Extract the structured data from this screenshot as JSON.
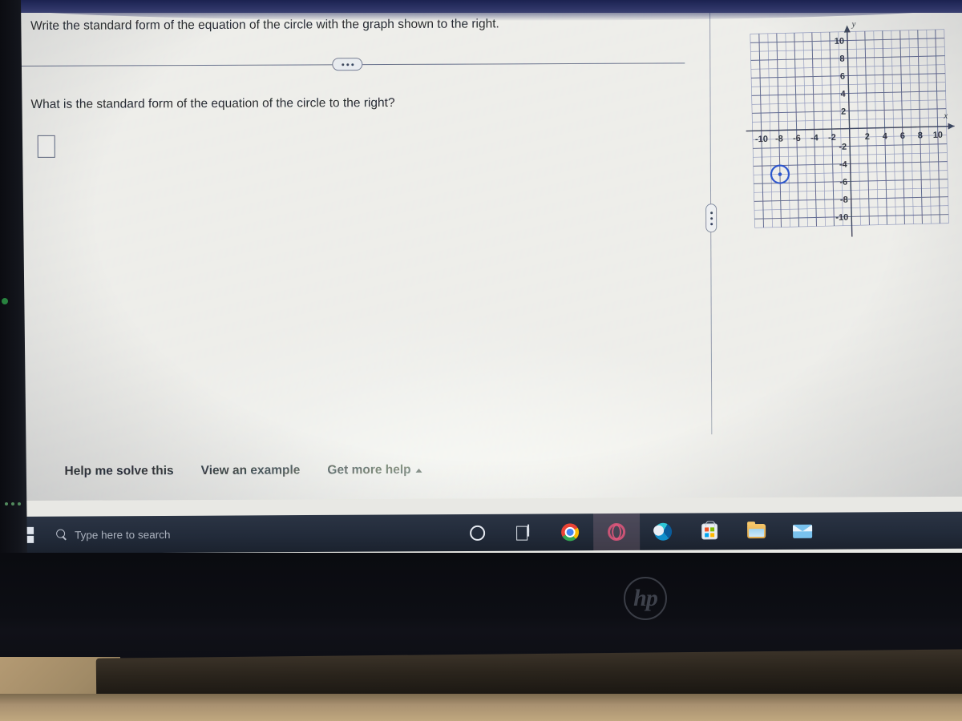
{
  "device": {
    "brand_logo": "hp",
    "brand_logo_name": "hp-logo"
  },
  "question": {
    "prompt": "Write the standard form of the equation of the circle with the graph shown to the right.",
    "sub_prompt": "What is the standard form of the equation of the circle to the right?",
    "answer_value": "",
    "answer_placeholder": "",
    "ellipsis_label": "•••"
  },
  "splitter": {
    "handle_label": "⋮"
  },
  "footer": {
    "links": [
      {
        "label": "Help me solve this",
        "name": "help-me-solve-this-link"
      },
      {
        "label": "View an example",
        "name": "view-an-example-link"
      },
      {
        "label": "Get more help",
        "name": "get-more-help-link",
        "caret": "up"
      }
    ]
  },
  "taskbar": {
    "start_label": "Start",
    "search_placeholder": "Type here to search",
    "search_value": "",
    "icons": [
      {
        "name": "cortana-icon",
        "label": "Cortana"
      },
      {
        "name": "task-view-icon",
        "label": "Task View"
      },
      {
        "name": "chrome-icon",
        "label": "Google Chrome"
      },
      {
        "name": "opera-icon",
        "label": "Opera"
      },
      {
        "name": "edge-icon",
        "label": "Microsoft Edge"
      },
      {
        "name": "microsoft-store-icon",
        "label": "Microsoft Store"
      },
      {
        "name": "file-explorer-icon",
        "label": "File Explorer"
      },
      {
        "name": "mail-icon",
        "label": "Mail"
      }
    ]
  },
  "colors": {
    "graph_axis": "#2d3550",
    "graph_grid": "#6a74a0",
    "circle_stroke": "#1b46c8",
    "page_background": "#ecece8",
    "taskbar": "#222b3a",
    "bezel_top": "#2a3163"
  },
  "chart_data": {
    "type": "scatter",
    "title": "",
    "xlabel": "x",
    "ylabel": "y",
    "xlim": [
      -11,
      11
    ],
    "ylim": [
      -11,
      11
    ],
    "grid": true,
    "minor_step": 1,
    "tick_step": 2,
    "xticks": [
      -10,
      -8,
      -6,
      -4,
      -2,
      2,
      4,
      6,
      8,
      10
    ],
    "yticks": [
      10,
      8,
      6,
      4,
      2,
      -2,
      -4,
      -6,
      -8,
      -10
    ],
    "xticklabels": [
      "-10",
      "-8",
      "-6",
      "-4",
      "-2",
      "2",
      "4",
      "6",
      "8",
      "10"
    ],
    "yticklabels": [
      "10",
      "8",
      "6",
      "4",
      "2",
      "-2",
      "-4",
      "-6",
      "-8",
      "-10"
    ],
    "axis_arrows": {
      "x": "right",
      "y": "up"
    },
    "shapes": [
      {
        "kind": "circle",
        "center": [
          -8,
          -5
        ],
        "radius": 1,
        "stroke": "#1b46c8",
        "fill": "none",
        "center_marker": true,
        "name": "graphed-circle"
      }
    ],
    "legend": null,
    "annotations": []
  }
}
